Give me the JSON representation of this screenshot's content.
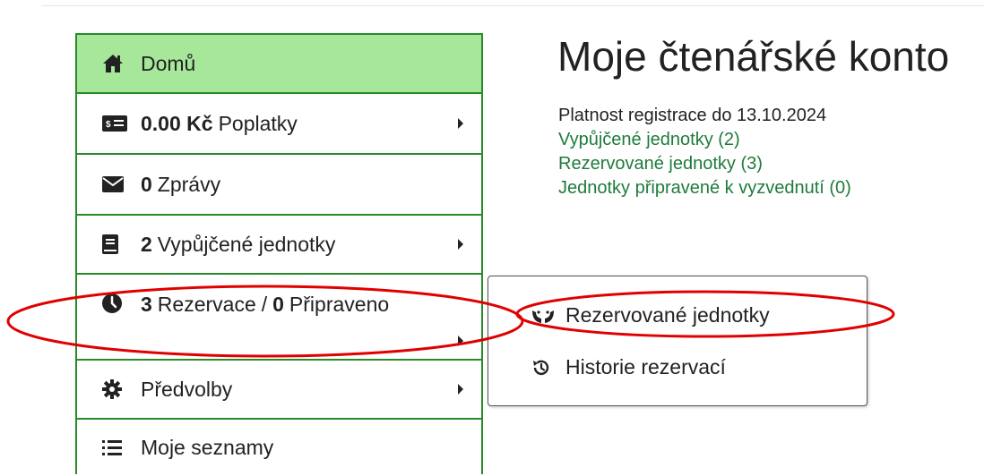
{
  "sidebar": {
    "items": [
      {
        "name": "home",
        "icon": "home-icon",
        "label": "Domů",
        "active": true
      },
      {
        "name": "fees",
        "icon": "money-icon",
        "bold": "0.00 Kč",
        "label": "Poplatky",
        "caret": true
      },
      {
        "name": "messages",
        "icon": "envelope-icon",
        "bold": "0",
        "label": "Zprávy"
      },
      {
        "name": "loans",
        "icon": "book-icon",
        "bold": "2",
        "label": "Vypůjčené jednotky",
        "caret": true
      },
      {
        "name": "reservations",
        "icon": "clock-icon",
        "bold": "3",
        "label": "Rezervace",
        "sep": "/",
        "bold2": "0",
        "label2": "Připraveno",
        "caret": true
      },
      {
        "name": "preferences",
        "icon": "gear-icon",
        "label": "Předvolby",
        "caret": true
      },
      {
        "name": "my-lists",
        "icon": "list-icon",
        "label": "Moje seznamy"
      }
    ]
  },
  "main": {
    "title": "Moje čtenářské konto",
    "registration": "Platnost registrace do 13.10.2024",
    "links": [
      "Vypůjčené jednotky (2)",
      "Rezervované jednotky (3)",
      "Jednotky připravené k vyzvednutí (0)"
    ]
  },
  "dropdown": {
    "items": [
      {
        "icon": "hands-icon",
        "label": "Rezervované jednotky"
      },
      {
        "icon": "history-icon",
        "label": "Historie rezervací"
      }
    ]
  },
  "colors": {
    "accent_border": "#2a8a2a",
    "active_bg": "#a6e79a",
    "link": "#1e7b3c",
    "annotation": "#e00000"
  }
}
